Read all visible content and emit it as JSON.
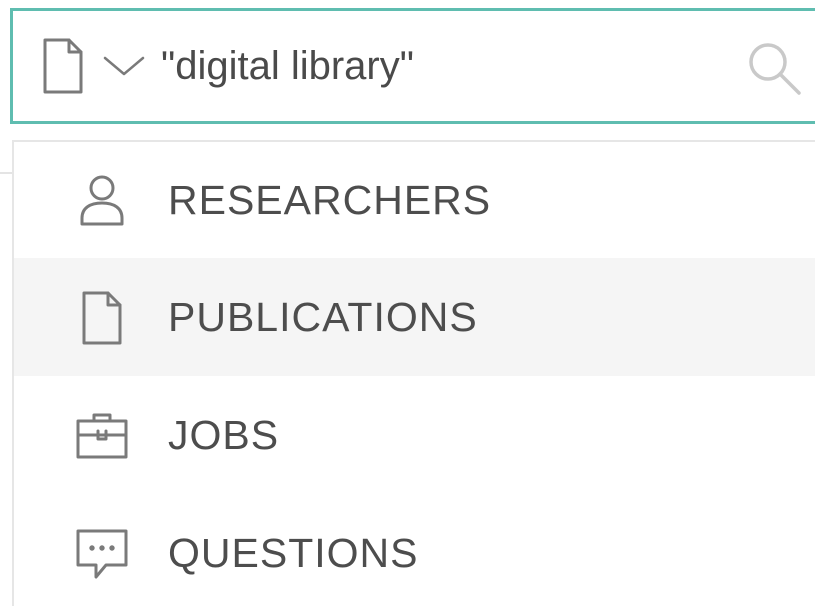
{
  "search": {
    "query": "\"digital library\"",
    "placeholder": "",
    "type_icon": "document-icon",
    "submit_icon": "search-icon"
  },
  "menu": {
    "items": [
      {
        "label": "RESEARCHERS",
        "icon": "person-icon",
        "highlighted": false
      },
      {
        "label": "PUBLICATIONS",
        "icon": "document-icon",
        "highlighted": true
      },
      {
        "label": "JOBS",
        "icon": "briefcase-icon",
        "highlighted": false
      },
      {
        "label": "QUESTIONS",
        "icon": "chat-bubble-icon",
        "highlighted": false
      }
    ]
  },
  "colors": {
    "accent_border": "#5fbdb0",
    "text": "#4d4d4d",
    "icon": "#7a7a7a",
    "highlight_bg": "#f5f5f5"
  }
}
